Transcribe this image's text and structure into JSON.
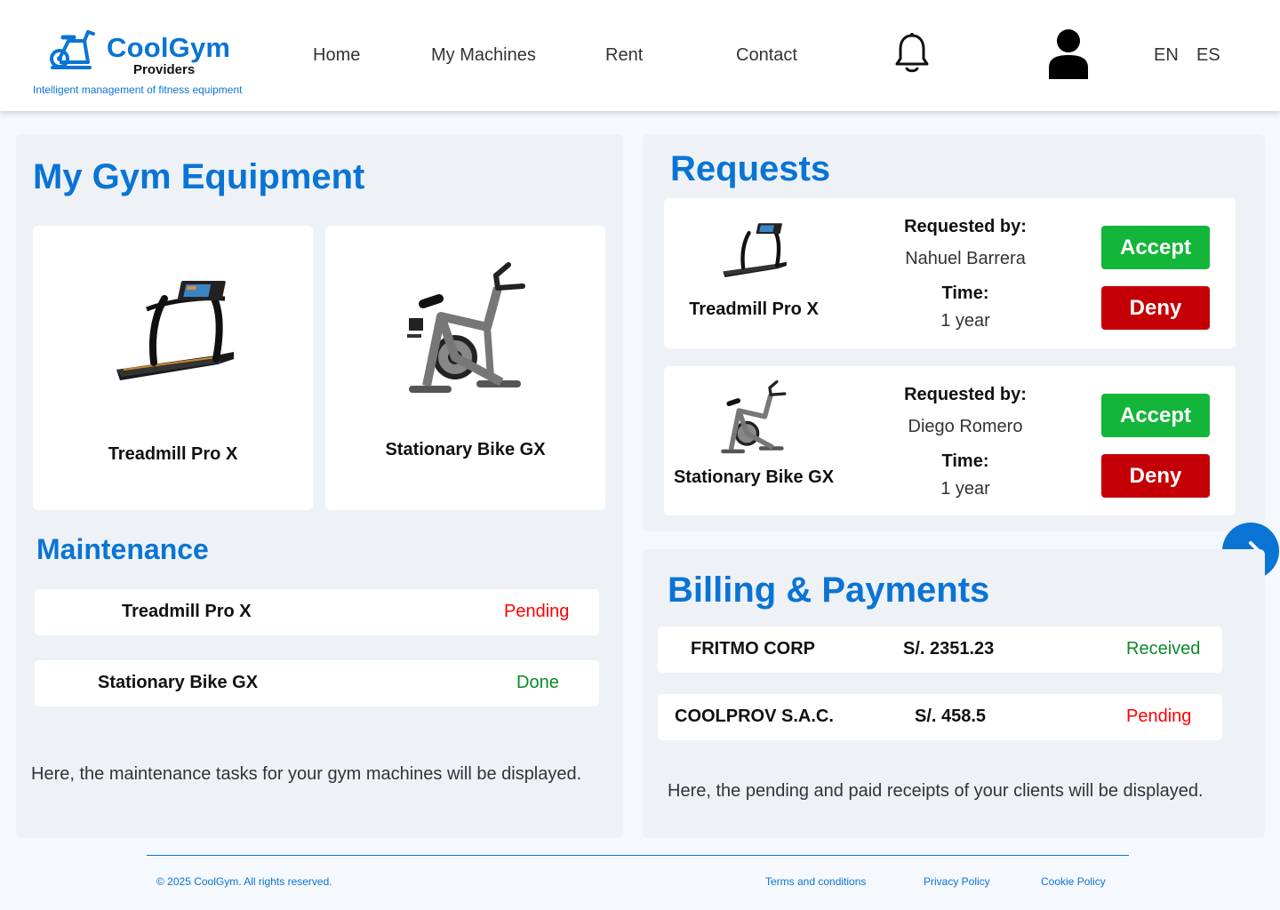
{
  "brand": {
    "name": "CoolGym",
    "sub": "Providers",
    "tagline": "Intelligent management of fitness equipment"
  },
  "nav": {
    "home": "Home",
    "machines": "My Machines",
    "rent": "Rent",
    "contact": "Contact",
    "lang_en": "EN",
    "lang_es": "ES"
  },
  "equipment": {
    "title": "My Gym Equipment",
    "items": [
      {
        "name": "Treadmill Pro X"
      },
      {
        "name": "Stationary Bike GX"
      }
    ]
  },
  "maintenance": {
    "title": "Maintenance",
    "items": [
      {
        "name": "Treadmill Pro X",
        "status": "Pending"
      },
      {
        "name": "Stationary Bike GX",
        "status": "Done"
      }
    ],
    "note": "Here, the maintenance tasks for your gym machines will be displayed."
  },
  "requests": {
    "title": "Requests",
    "requested_by_label": "Requested by:",
    "time_label": "Time:",
    "accept_label": "Accept",
    "deny_label": "Deny",
    "items": [
      {
        "machine": "Treadmill Pro X",
        "requester": "Nahuel Barrera",
        "time": "1 year"
      },
      {
        "machine": "Stationary Bike GX",
        "requester": "Diego Romero",
        "time": "1 year"
      }
    ]
  },
  "billing": {
    "title": "Billing & Payments",
    "items": [
      {
        "client": "FRITMO CORP",
        "amount": "S/. 2351.23",
        "status": "Received"
      },
      {
        "client": "COOLPROV S.A.C.",
        "amount": "S/. 458.5",
        "status": "Pending"
      }
    ],
    "note": "Here, the pending and paid receipts of your clients will be displayed."
  },
  "footer": {
    "copyright": "© 2025 CoolGym. All rights reserved.",
    "terms": "Terms and conditions",
    "privacy": "Privacy Policy",
    "cookie": "Cookie Policy"
  },
  "colors": {
    "brand_blue": "#0a74d4",
    "accept_green": "#13b53a",
    "deny_red": "#c40006",
    "pending_red": "#ff0000",
    "done_green": "#0a8a2a"
  },
  "icons": {
    "logo": "exercise-bike-icon",
    "notifications": "bell-icon",
    "profile": "user-icon",
    "next": "arrow-right-icon"
  }
}
